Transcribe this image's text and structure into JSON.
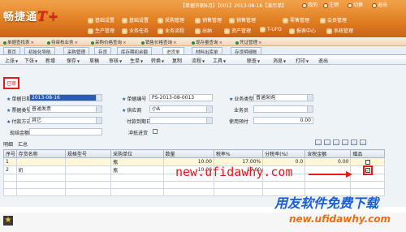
{
  "header": {
    "logo_text": "畅捷通",
    "logo_plus": "T+",
    "info": "【单据许朝6月】【001】2013-08-16【演示单】",
    "top_buttons": [
      "我的",
      "注销",
      "切换",
      "退出"
    ],
    "menu_row1": [
      "基础设置",
      "基础设置",
      "采购管理",
      "销售管理",
      "销售管理",
      "零售管理",
      "会员管理"
    ],
    "menu_row2": [
      "生产管理",
      "业务任务",
      "业务流程",
      "出纳",
      "资产管理",
      "T-UFO",
      "报表中心",
      "系统管理"
    ]
  },
  "module_tabs": [
    "单据查找表",
    "待审核业务",
    "采购价格查询",
    "销售价格查询",
    "现存量查询",
    "凭证管理"
  ],
  "doc_tabs": [
    "首页",
    "初始化导航",
    "采购管理",
    "存货",
    "库存期初余额",
    "进货单",
    "材料出库单",
    "存货明细账"
  ],
  "toolbar": [
    "上张",
    "下张",
    "新增",
    "保存",
    "草稿",
    "审核",
    "生单",
    "转换",
    "复制",
    "流程",
    "工具",
    "联查",
    "消息",
    "打印",
    "退出"
  ],
  "audit_label": "已审",
  "form": {
    "doc_date_label": "单据日期",
    "doc_date": "2013-08-16",
    "doc_no_label": "单据编号",
    "doc_no": "PS-2013-08-0013",
    "biz_type_label": "业务类型",
    "biz_type": "普通采购",
    "invoice_type_label": "票据类型",
    "invoice_type": "普通发票",
    "supplier_label": "供应商",
    "supplier": "小A",
    "staff_label": "业务员",
    "staff": "",
    "pay_method_label": "付款方式",
    "pay_method": "其它",
    "pay_due_label": "付款到期日",
    "pay_due": "",
    "use_prepay_label": "使用预付",
    "use_prepay": "0.00",
    "tax_label": "现结金额",
    "tax": "",
    "rebate_label": "冲抵进货"
  },
  "grid": {
    "tabs": [
      "明细",
      "汇总"
    ],
    "headers": [
      "序号",
      "存货名称",
      "规格型号",
      "采购单位",
      "数量",
      "税率%",
      "分税率(%)",
      "含税金额",
      "赠品"
    ],
    "rows": [
      {
        "no": "1",
        "name": "",
        "spec": "",
        "unit": "瓶",
        "qty": "10.00",
        "tax": "17.00%",
        "price": "0.0",
        "amount": "0.00",
        "gift": false
      },
      {
        "no": "2",
        "name": "奶",
        "spec": "",
        "unit": "瓶",
        "qty": "10.00",
        "tax": "17.00",
        "price": "",
        "amount": "",
        "gift": true
      }
    ]
  },
  "watermark": {
    "line1": "new.ufidawhy.com",
    "line2": "用友软件免费下载",
    "line3": "new.ufidawhy.com"
  }
}
